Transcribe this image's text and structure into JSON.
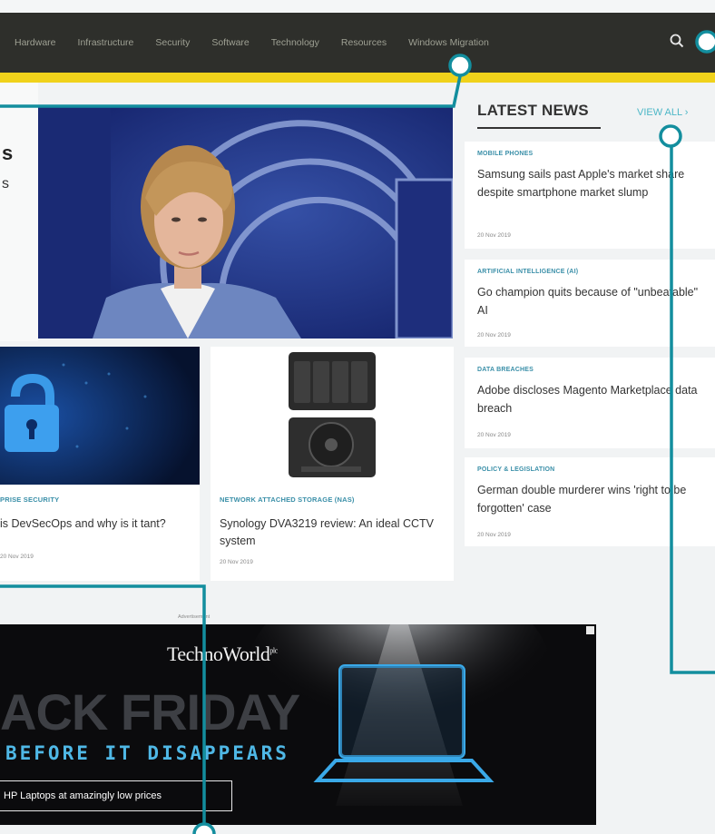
{
  "nav": {
    "items": [
      "Hardware",
      "Infrastructure",
      "Security",
      "Software",
      "Technology",
      "Resources",
      "Windows Migration"
    ]
  },
  "hero": {
    "headline_fragment": "s",
    "sub_fragment": "s"
  },
  "cards": [
    {
      "category": "PRISE SECURITY",
      "title": "is DevSecOps and why is it tant?",
      "date": "20 Nov 2019"
    },
    {
      "category": "NETWORK ATTACHED STORAGE (NAS)",
      "title": "Synology DVA3219 review: An ideal CCTV system",
      "date": "20 Nov 2019"
    }
  ],
  "latest": {
    "heading": "LATEST NEWS",
    "view_all": "VIEW ALL ›",
    "items": [
      {
        "category": "MOBILE PHONES",
        "title": "Samsung sails past Apple's market share despite smartphone market slump",
        "date": "20 Nov 2019"
      },
      {
        "category": "ARTIFICIAL INTELLIGENCE (AI)",
        "title": "Go champion quits because of \"unbeatable\" AI",
        "date": "20 Nov 2019"
      },
      {
        "category": "DATA BREACHES",
        "title": "Adobe discloses Magento Marketplace data breach",
        "date": "20 Nov 2019"
      },
      {
        "category": "POLICY & LEGISLATION",
        "title": "German double murderer wins 'right to be forgotten' case",
        "date": "20 Nov 2019"
      }
    ]
  },
  "advert": {
    "label": "Advertisement",
    "logo": "TechnoWorld",
    "logo_suffix": "plc",
    "headline": "ACK FRIDAY",
    "subline": "BEFORE IT DISAPPEARS",
    "cta": "HP Laptops at amazingly low prices"
  },
  "colors": {
    "nav_bg": "#2e2f2b",
    "accent_yellow": "#f0d21b",
    "annotation_teal": "#138e9e",
    "category_blue": "#3a8fa8"
  }
}
